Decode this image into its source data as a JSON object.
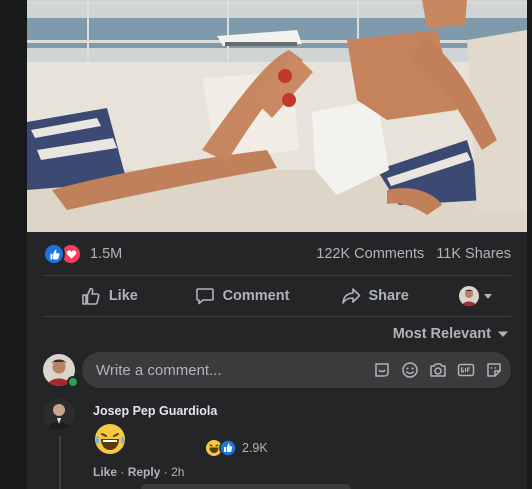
{
  "stats": {
    "reaction_count": "1.5M",
    "comments": "122K Comments",
    "shares": "11K Shares"
  },
  "actions": {
    "like": "Like",
    "comment": "Comment",
    "share": "Share"
  },
  "sort": {
    "label": "Most Relevant"
  },
  "composer": {
    "placeholder": "Write a comment..."
  },
  "comment": {
    "author": "Josep Pep Guardiola",
    "emoji": "laughing-tears-emoji",
    "reaction_count": "2.9K",
    "like": "Like",
    "reply": "Reply",
    "time": "2h"
  },
  "colors": {
    "background": "#18191a",
    "card": "#242526",
    "input": "#3a3b3c",
    "text_primary": "#e4e6eb",
    "text_secondary": "#b0b3b8",
    "like_blue": "#1b74e4",
    "love_red": "#f33e58",
    "online_green": "#31a24c"
  }
}
